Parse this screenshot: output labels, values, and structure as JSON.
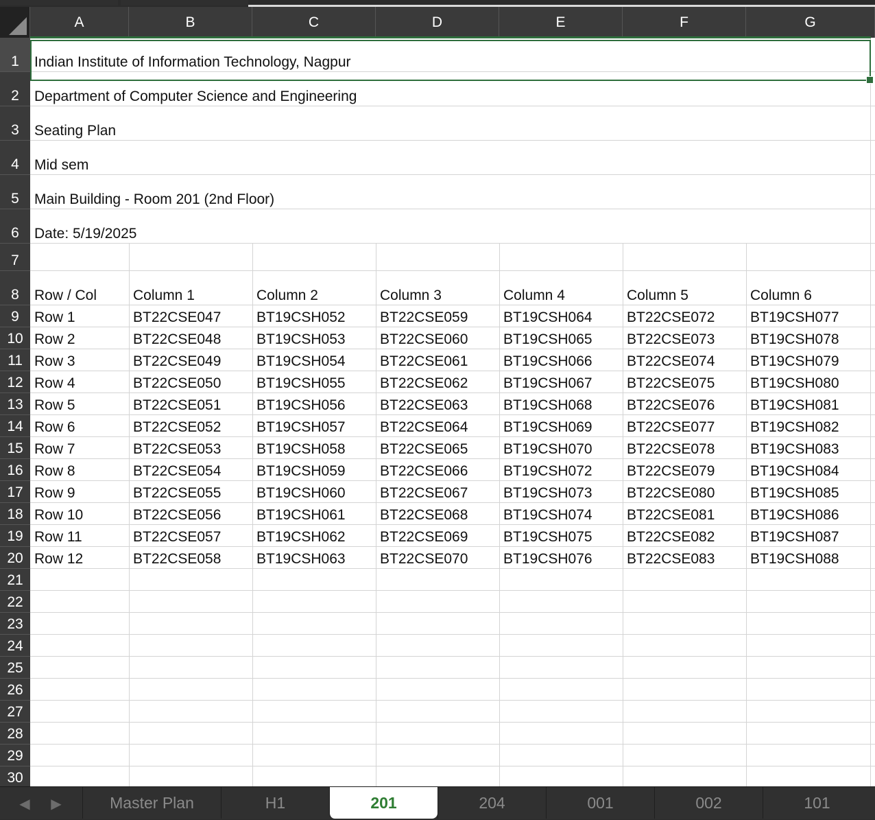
{
  "sheet": {
    "columns": [
      "A",
      "B",
      "C",
      "D",
      "E",
      "F",
      "G"
    ],
    "rows": [
      {
        "num": "1",
        "cells": [
          "Indian Institute of Information Technology, Nagpur"
        ]
      },
      {
        "num": "2",
        "cells": [
          "Department of Computer Science and Engineering"
        ]
      },
      {
        "num": "3",
        "cells": [
          "Seating Plan"
        ]
      },
      {
        "num": "4",
        "cells": [
          "Mid sem"
        ]
      },
      {
        "num": "5",
        "cells": [
          "Main Building - Room 201 (2nd Floor)"
        ]
      },
      {
        "num": "6",
        "cells": [
          "Date: 5/19/2025"
        ]
      },
      {
        "num": "7",
        "cells": []
      },
      {
        "num": "8",
        "cells": [
          "Row / Col",
          "Column 1",
          "Column 2",
          "Column 3",
          "Column 4",
          "Column 5",
          "Column 6"
        ]
      },
      {
        "num": "9",
        "cells": [
          "Row 1",
          "BT22CSE047",
          "BT19CSH052",
          "BT22CSE059",
          "BT19CSH064",
          "BT22CSE072",
          "BT19CSH077"
        ]
      },
      {
        "num": "10",
        "cells": [
          "Row 2",
          "BT22CSE048",
          "BT19CSH053",
          "BT22CSE060",
          "BT19CSH065",
          "BT22CSE073",
          "BT19CSH078"
        ]
      },
      {
        "num": "11",
        "cells": [
          "Row 3",
          "BT22CSE049",
          "BT19CSH054",
          "BT22CSE061",
          "BT19CSH066",
          "BT22CSE074",
          "BT19CSH079"
        ]
      },
      {
        "num": "12",
        "cells": [
          "Row 4",
          "BT22CSE050",
          "BT19CSH055",
          "BT22CSE062",
          "BT19CSH067",
          "BT22CSE075",
          "BT19CSH080"
        ]
      },
      {
        "num": "13",
        "cells": [
          "Row 5",
          "BT22CSE051",
          "BT19CSH056",
          "BT22CSE063",
          "BT19CSH068",
          "BT22CSE076",
          "BT19CSH081"
        ]
      },
      {
        "num": "14",
        "cells": [
          "Row 6",
          "BT22CSE052",
          "BT19CSH057",
          "BT22CSE064",
          "BT19CSH069",
          "BT22CSE077",
          "BT19CSH082"
        ]
      },
      {
        "num": "15",
        "cells": [
          "Row 7",
          "BT22CSE053",
          "BT19CSH058",
          "BT22CSE065",
          "BT19CSH070",
          "BT22CSE078",
          "BT19CSH083"
        ]
      },
      {
        "num": "16",
        "cells": [
          "Row 8",
          "BT22CSE054",
          "BT19CSH059",
          "BT22CSE066",
          "BT19CSH072",
          "BT22CSE079",
          "BT19CSH084"
        ]
      },
      {
        "num": "17",
        "cells": [
          "Row 9",
          "BT22CSE055",
          "BT19CSH060",
          "BT22CSE067",
          "BT19CSH073",
          "BT22CSE080",
          "BT19CSH085"
        ]
      },
      {
        "num": "18",
        "cells": [
          "Row 10",
          "BT22CSE056",
          "BT19CSH061",
          "BT22CSE068",
          "BT19CSH074",
          "BT22CSE081",
          "BT19CSH086"
        ]
      },
      {
        "num": "19",
        "cells": [
          "Row 11",
          "BT22CSE057",
          "BT19CSH062",
          "BT22CSE069",
          "BT19CSH075",
          "BT22CSE082",
          "BT19CSH087"
        ]
      },
      {
        "num": "20",
        "cells": [
          "Row 12",
          "BT22CSE058",
          "BT19CSH063",
          "BT22CSE070",
          "BT19CSH076",
          "BT22CSE083",
          "BT19CSH088"
        ]
      },
      {
        "num": "21",
        "cells": []
      },
      {
        "num": "22",
        "cells": []
      },
      {
        "num": "23",
        "cells": []
      },
      {
        "num": "24",
        "cells": []
      },
      {
        "num": "25",
        "cells": []
      },
      {
        "num": "26",
        "cells": []
      },
      {
        "num": "27",
        "cells": []
      },
      {
        "num": "28",
        "cells": []
      },
      {
        "num": "29",
        "cells": []
      },
      {
        "num": "30",
        "cells": []
      }
    ]
  },
  "tabs": [
    {
      "label": "Master Plan",
      "active": false
    },
    {
      "label": "H1",
      "active": false
    },
    {
      "label": "201",
      "active": true
    },
    {
      "label": "204",
      "active": false
    },
    {
      "label": "001",
      "active": false
    },
    {
      "label": "002",
      "active": false
    },
    {
      "label": "101",
      "active": false
    }
  ],
  "nav": {
    "prev_icon": "◀",
    "next_icon": "▶"
  },
  "colors": {
    "accent": "#2e7d32",
    "selection": "#2e6e3c"
  }
}
